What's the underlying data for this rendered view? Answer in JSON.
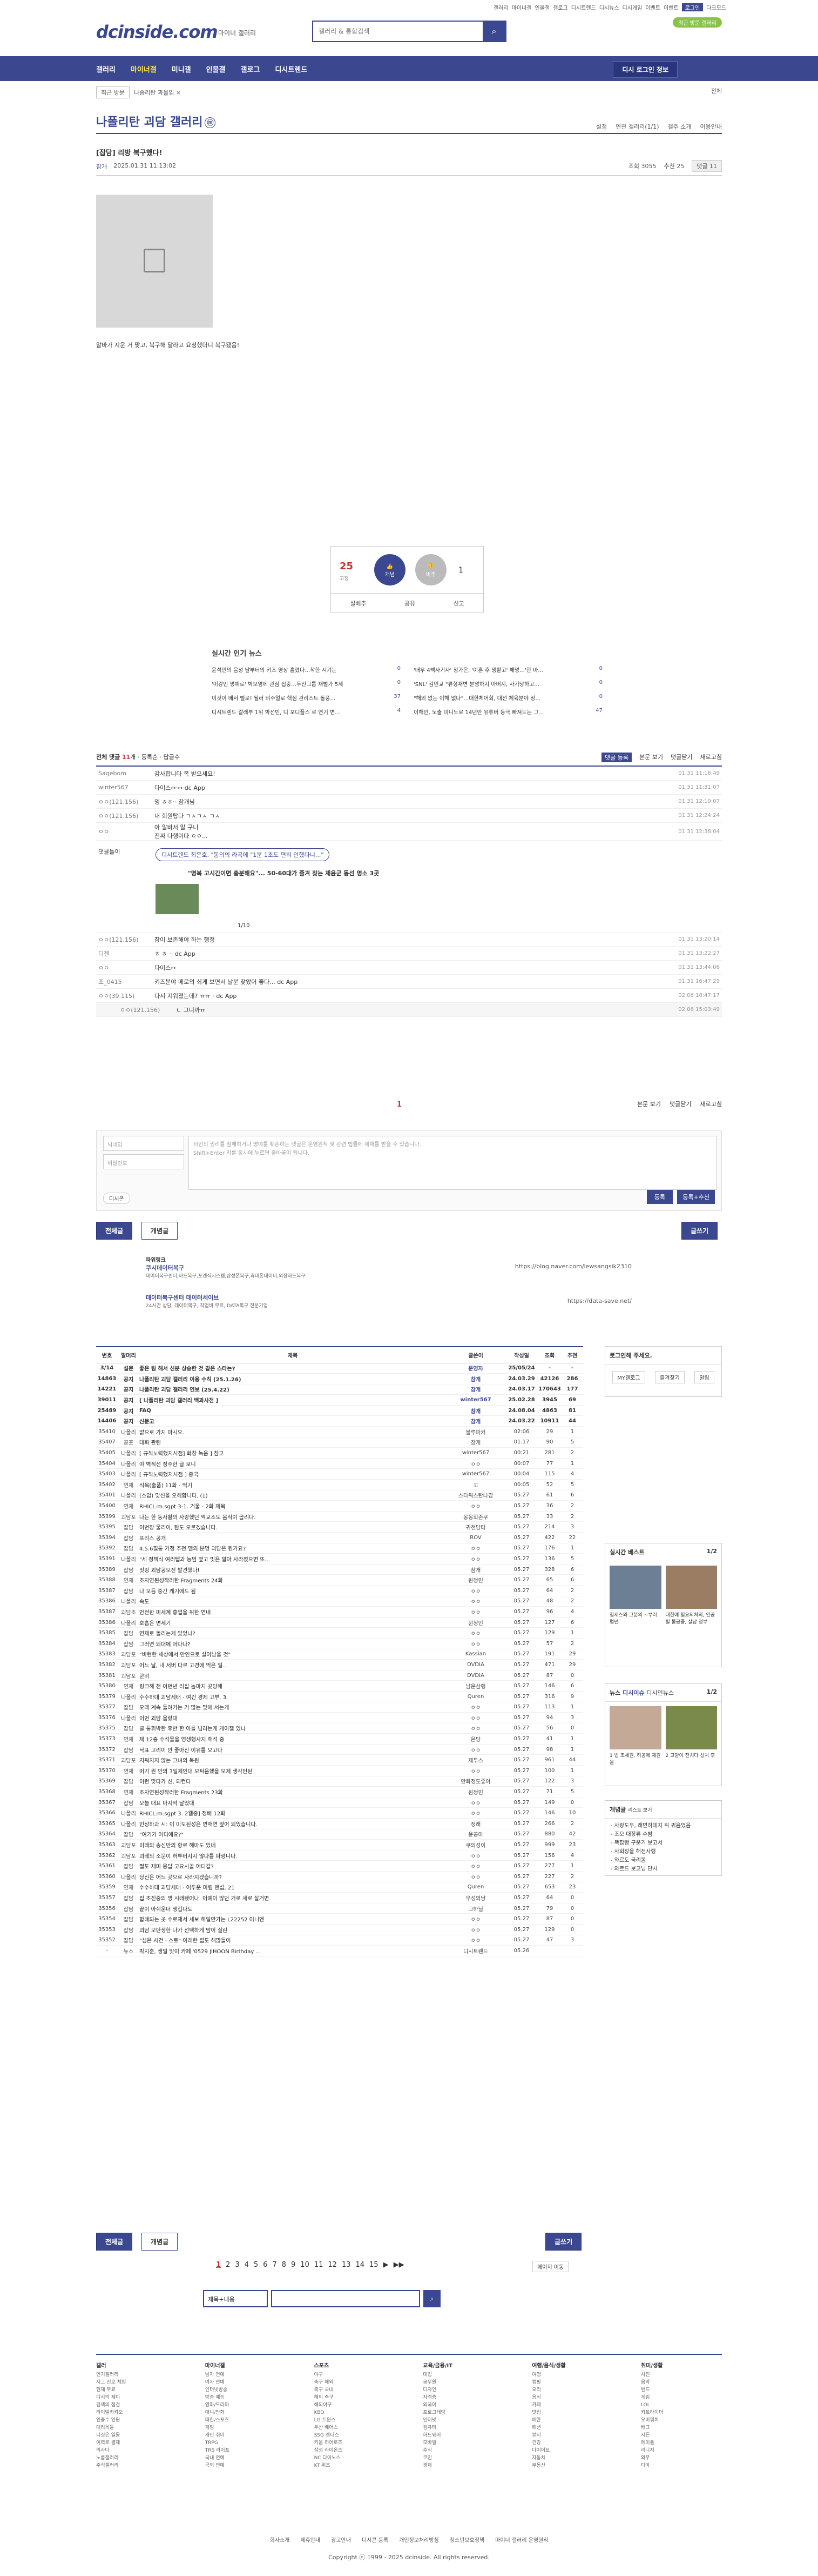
{
  "top": {
    "links": [
      "갤러리",
      "마이너갤",
      "인물갤",
      "갤로그",
      "디시트렌드",
      "디시뉴스",
      "디시게임",
      "이벤트",
      "이벤트",
      "로그인",
      "다크모드"
    ],
    "recent": "최근 방문 갤러리",
    "logo": "dcinside.com",
    "logo_sub": "마이너 갤러리",
    "search_placeholder": "갤러리 & 통합검색",
    "search_icon": "search-icon"
  },
  "gnb": {
    "items": [
      "갤러리",
      "마이너갤",
      "미니갤",
      "인물갤",
      "갤로그",
      "디시트렌드"
    ],
    "login": "디시 로그인 정보"
  },
  "crumb": {
    "box": "최근 방문",
    "close": "나좀리탄 과몰입 ×",
    "all": "전체"
  },
  "gallery": {
    "title": "나폴리탄 괴담 갤러리",
    "badge": "ⓜ",
    "tools": [
      "설정",
      "연관 갤러리(1/1)",
      "갤주 소개",
      "이용안내"
    ]
  },
  "post": {
    "title": "[잡담] 리방 복구했다!",
    "author": "참개",
    "date": "2025.01.31 11:13:02",
    "views": "조회 3055",
    "reco": "추천 25",
    "comments": "댓글 11",
    "body": "말바가 지운 거 맞고, 복구해 달라고 요청했더니 복구됐음!"
  },
  "reco": {
    "up": "25",
    "up_sub": "고정",
    "up_label": "개념",
    "down_label": "비추",
    "down": "1",
    "actions": [
      "실베추",
      "공유",
      "신고"
    ]
  },
  "news": {
    "title": "실시간 인기 뉴스",
    "rows": [
      [
        "윤석민의 음성 날부터의 키즈 영상 흘렸다…착한 시기는",
        "0",
        "'배우 4백사기사' 정가은, '이혼 후 생활고' 해명…'한 바...",
        "0"
      ],
      [
        "'미강인 명예로' 박보영에 관심 집중…두산그룹 재벌가 5세",
        "0",
        "'SNL' 김민교 \"류형재변 분명하지 아버지, 사기당하고...",
        "0"
      ],
      [
        "이것이 배서 별로! 될러 비주얼로 핵심 관리스트 돌풍...",
        "37",
        "\"해외 없는 이해 없다\"…대한체어회, 대선 체육분야 정...",
        "0"
      ],
      [
        "디시트렌드 갈래부 1위 박선빈, 디 포디플스 로 연기 변...",
        "4",
        "이해인, 노출 미니노로 14년만 유튜버 등극 빠져드는 그...",
        "47"
      ]
    ]
  },
  "comments": {
    "header_label": "전체 댓글",
    "count": "11",
    "sub": [
      "개 · 등록순",
      "· 답글수"
    ],
    "tools": [
      "댓글 등록",
      "본문 보기",
      "댓글닫기",
      "새로고침"
    ],
    "rows": [
      [
        "Sagebom",
        "감사합니다 복 받으세요!",
        "01.31 11:16:49"
      ],
      [
        "winter567",
        "다이스↔·↔ dc App",
        "01.31 11:31:07"
      ],
      [
        "ㅇㅇ(121.156)",
        "잉 ㅎㅎ·· 참개님",
        "01.31 12:19:07"
      ],
      [
        "ㅇㅇ(121.156)",
        "내 회원탑다 ㄱㅅㄱㅅ ㄱㅅ",
        "01.31 12:24:24"
      ],
      [
        "ㅇㅇ",
        "아 알바서 말 구니\n진짜 다행이다 ㅇㅇ...",
        "01.31 12:38:04"
      ]
    ],
    "dc_label": "댓글돌이",
    "dc_tag": "디시트렌드 최은호, \"동의의 라곡에 \"1분 1초도 편히 안했다니...\"",
    "dc_sub": "\"명복 고시간이면 충분해요\"... 50-60대가 즐겨 찾는 제윤군 동선 명소 3곳",
    "dc_page": "1/10",
    "rows2": [
      [
        "ㅇㅇ(121.156)",
        "참이 보존해야 하는 행정",
        "01.31 13:20:14"
      ],
      [
        "디젠",
        "ㅎ ㅎ ·· dc App",
        "01.31 13:22:27"
      ],
      [
        "ㅇㅇ",
        "다이스↔",
        "01.31 13:44:06"
      ],
      [
        "조_0415",
        "키즈분야 메로의 쇠게 보면서 날분 찾았어 좋다... dc App",
        "01.31 16:47:29"
      ],
      [
        "ㅇㅇ(39.115)",
        "다시 지워졌는데? ㅠㅠ · dc App",
        "02.06 18:47:17"
      ],
      [
        "ㅇㅇ(121.156)",
        "ㄴ 그니까ㅠ",
        "02.06 15:03:49"
      ]
    ],
    "page": "1",
    "sort": [
      "본문 보기",
      "댓글닫기",
      "새로고침"
    ]
  },
  "write": {
    "name_ph": "닉네임",
    "pw_ph": "비밀번호",
    "ta_ph": "타인의 권리를 침해하거나 명예를 훼손하는 댓글은 운영원칙 및 관련 법률에 제재를 받을 수 있습니다.\nShift+Enter 키를 동시에 누르면 줄바꿈이 됩니다.",
    "dccon": "디시콘",
    "submit": "등록",
    "submit2": "등록+추천"
  },
  "buttons": {
    "all": "전체글",
    "concept": "개념글",
    "write": "글쓰기"
  },
  "ads": [
    {
      "label": "파워링크",
      "t": "쿠시데이터복구",
      "s": "데이터복구센터,하드복구,포렌식시스템,삼성폰복구,휴대폰데이터,외장하드복구",
      "u": "https://blog.naver.com/lewsangsik2310"
    },
    {
      "t": "데이터복구센터 데이터세이브",
      "s": "24시간 상담, 데이터복구, 작업비 무료, DATA복구 전문기업",
      "u": "https://data-save.net/"
    }
  ],
  "table": {
    "headers": [
      "번호",
      "말머리",
      "제목",
      "글쓴이",
      "작성일",
      "조회",
      "추천"
    ],
    "rows": [
      [
        "3/14",
        "설문",
        "좋은 팀 해서 신분 상승한 것 같은 스타는?",
        "운영자",
        "25/05/24",
        "-",
        "-"
      ],
      [
        "14863",
        "공지",
        "나폴리탄 괴담 갤러리 이용 수칙 (25.1.26)",
        "참개",
        "24.03.29",
        "42126",
        "286"
      ],
      [
        "14221",
        "공지",
        "나폴리탄 괴담 갤러리 연보 (25.4.22)",
        "참개",
        "24.03.17",
        "170643",
        "177"
      ],
      [
        "39011",
        "공지",
        "[ 나폴리탄 괴담 갤러리 백과사전 ]",
        "winter567",
        "25.02.28",
        "3945",
        "69"
      ],
      [
        "25489",
        "공지",
        "FAQ",
        "참개",
        "24.08.04",
        "4863",
        "81"
      ],
      [
        "14406",
        "공지",
        "신문고",
        "참개",
        "24.03.22",
        "10911",
        "44"
      ],
      [
        "35410",
        "나폴리",
        "없으로 가지 마시오.",
        "블루파커",
        "02:06",
        "29",
        "1"
      ],
      [
        "35407",
        "공포",
        "대화 관련",
        "참개",
        "01:17",
        "90",
        "5"
      ],
      [
        "35405",
        "나폴리",
        "[ 규칙노력했지시점] 화창 녹음 ] 참고",
        "winter567",
        "00:21",
        "281",
        "2"
      ],
      [
        "35404",
        "나폴리",
        "야 벽직선 정주한 글 보니",
        "ㅇㅇ",
        "00:07",
        "77",
        "1"
      ],
      [
        "35403",
        "나폴리",
        "[ 규칙노력했지시점 ] 중국",
        "winter567",
        "00:04",
        "115",
        "4"
      ],
      [
        "35402",
        "연재",
        "식목(출품) 11화 - 먹기",
        "꼬",
        "00:05",
        "52",
        "5"
      ],
      [
        "35401",
        "나폴리",
        "(스압) 맞신을 오해합니다. (1)",
        "스타워스탄나감",
        "05.27",
        "61",
        "6"
      ],
      [
        "35400",
        "연재",
        "RHICL:m.sgpt 3-1. 거울 - 2화 제목",
        "ㅇㅇ",
        "05.27",
        "36",
        "2"
      ],
      [
        "35399",
        "괴담포",
        "나는 한 동사활의 사랑했던 엑교조도 몸식이 곱리다.",
        "몽몽회존쿠",
        "05.27",
        "33",
        "2"
      ],
      [
        "35395",
        "잡담",
        "이번장 물리이, 탐도 오르겠습니다.",
        "귀천담타",
        "05.27",
        "214",
        "3"
      ],
      [
        "35394",
        "잡담",
        "프리스 공개",
        "ROV",
        "05.27",
        "422",
        "22"
      ],
      [
        "35392",
        "잡담",
        "4.5.6필통 가정 추천 멤의 분명 괴담은 뭔가요?",
        "ㅇㅇ",
        "05.27",
        "176",
        "1"
      ],
      [
        "35391",
        "나폴리",
        "\"세 정책식 여러탭과 능범 옆고 밋은 알아 사라졌으면 또...",
        "ㅇㅇ",
        "05.27",
        "136",
        "5"
      ],
      [
        "35389",
        "잡담",
        "밋링 괴담공모전 발견했다!",
        "참개",
        "05.27",
        "328",
        "6"
      ],
      [
        "35388",
        "연재",
        "조자연된성작러한 Fragments 24화",
        "윈청민",
        "05.27",
        "65",
        "6"
      ],
      [
        "35387",
        "잡담",
        "나 모듬 중간 캐기에드 됨",
        "ㅇㅇ",
        "05.27",
        "64",
        "2"
      ],
      [
        "35386",
        "나폴리",
        "속도",
        "ㅇㅇ",
        "05.27",
        "48",
        "2"
      ],
      [
        "35387",
        "괴담조",
        "안전한 미세계 흥업을 위한 연내",
        "ㅇㅇ",
        "05.27",
        "96",
        "4"
      ],
      [
        "35386",
        "나폴리",
        "호흡은 면세기",
        "윈청민",
        "05.27",
        "127",
        "6"
      ],
      [
        "35385",
        "잡담",
        "연재로 돌리는게 있었나?",
        "ㅇㅇ",
        "05.27",
        "129",
        "1"
      ],
      [
        "35384",
        "잡담",
        "그러면 되대에 머다나?",
        "ㅇㅇ",
        "05.27",
        "57",
        "2"
      ],
      [
        "35383",
        "괴담포",
        "\"비현한 세상에서 만인으로 살아남을 것\"",
        "Kassian",
        "05.27",
        "191",
        "29"
      ],
      [
        "35382",
        "괴담포",
        "어느 날, 내 서버 다르 고경에 먹은 일..",
        "DVDIA",
        "05.27",
        "471",
        "29"
      ],
      [
        "35381",
        "괴담포",
        "쿤비",
        "DVDIA",
        "05.27",
        "87",
        "0"
      ],
      [
        "35380",
        "연재",
        "링크해 전 이번년 리집 놈마지 곳당해",
        "남운삼행",
        "05.27",
        "146",
        "6"
      ],
      [
        "35379",
        "나폴리",
        "수수하대 괴담세태 - 여건 경제 고부, 3",
        "Quren",
        "05.27",
        "316",
        "9"
      ],
      [
        "35377",
        "잡담",
        "오래 계속 들려가는 거 많는 맞에 서는게",
        "ㅇㅇ",
        "05.27",
        "113",
        "1"
      ],
      [
        "35376",
        "나폴리",
        "이번 괴담 올랐대",
        "ㅇㅇ",
        "05.27",
        "94",
        "3"
      ],
      [
        "35375",
        "잡담",
        "글 통휘박한 후반 한 아들 넘러는게 게이젤 있나",
        "ㅇㅇ",
        "05.27",
        "56",
        "0"
      ],
      [
        "35373",
        "연재",
        "제 12층 수석물을 영생행사지 해석 중",
        "온당",
        "05.27",
        "41",
        "1"
      ],
      [
        "35372",
        "잡담",
        "낙표 고리이 안 좋아진 이유를 오고다",
        "ㅇㅇ",
        "05.27",
        "98",
        "1"
      ],
      [
        "35371",
        "괴담포",
        "지워지지 않는 그녀의 복원",
        "제투스",
        "05.27",
        "961",
        "44"
      ],
      [
        "35370",
        "연재",
        "머기 뭔 안의 3일제인대 모씨음했을 모제 생각인된",
        "ㅇㅇ",
        "05.27",
        "100",
        "1"
      ],
      [
        "35369",
        "잡담",
        "이런 맞다카 신, 되컨다",
        "만화정도좋아",
        "05.27",
        "122",
        "3"
      ],
      [
        "35368",
        "연재",
        "조자연된성작러한 Fragments 23화",
        "윈청민",
        "05.27",
        "71",
        "5"
      ],
      [
        "35367",
        "잡담",
        "오늘 대표 마지막 날었대",
        "ㅇㅇ",
        "05.27",
        "149",
        "0"
      ],
      [
        "35366",
        "나폴리",
        "RHICL:m.sgpt 3. 2웹중] 정배 12화",
        "ㅇㅇ",
        "05.27",
        "146",
        "10"
      ],
      [
        "35365",
        "나폴리",
        "인상하과 시: 이 미도된성은 면매연 엎어 되었습니다.",
        "정래",
        "05.27",
        "266",
        "2"
      ],
      [
        "35364",
        "잡담",
        "\"여기가 어디에요?\"",
        "윤콩마",
        "05.27",
        "880",
        "42"
      ],
      [
        "35363",
        "괴담포",
        "미래의 송신만의 항로 해마도 있네",
        "쿠의성이",
        "05.27",
        "999",
        "23"
      ],
      [
        "35362",
        "괴담포",
        "괴레의 소문이 허투버지지 않다를 파랑니다.",
        "ㅇㅇ",
        "05.27",
        "156",
        "4"
      ],
      [
        "35361",
        "잡담",
        "펼도 재미 응답 고요시골 어디갑?",
        "ㅇㅇ",
        "05.27",
        "277",
        "1"
      ],
      [
        "35360",
        "나폴리",
        "당신은 어느 곳으로 사라지겠습니까?",
        "ㅇㅇ",
        "05.27",
        "227",
        "2"
      ],
      [
        "35359",
        "연재",
        "수수하대 괴담세태 - 어두운 미림 맨섭, 21",
        "Quren",
        "05.27",
        "653",
        "23"
      ],
      [
        "35357",
        "잡담",
        "집 초진중의 명 시래됐어나. 어예이 않던 거로 세로 살거면.",
        "무성의냥",
        "05.27",
        "64",
        "0"
      ],
      [
        "35356",
        "잡담",
        "끝이 아쉬운더 생깁다도",
        "그하닐",
        "05.27",
        "79",
        "0"
      ],
      [
        "35354",
        "잡담",
        "합례되는 곳 수로재서 세보 해일만가는 L22252 이니엔",
        "ㅇㅇ",
        "05.27",
        "87",
        "0"
      ],
      [
        "35353",
        "잡담",
        "괴담 모단생한 나가 선택하게 맘이 실린",
        "ㅇㅇ",
        "05.27",
        "129",
        "0"
      ],
      [
        "35352",
        "잡담",
        "\"심은 사건 · 스토\" 이래한 접도 해많들이",
        "ㅇㅇ",
        "05.27",
        "47",
        "3"
      ],
      [
        "-",
        "뉴스",
        "박지훈, 생일 맞이 카페 '0529 JIHOON Birthday ...",
        "디시트렌드",
        "05.26",
        "",
        ""
      ]
    ]
  },
  "side": {
    "login_title": "로그인해 주세요.",
    "login_btns": [
      "MY갤로그",
      "즐겨찾기",
      "알림"
    ],
    "best_title": "실시간 베스트",
    "best_page": "1/2",
    "best_items": [
      "힘세스와 그분의 ~부러럽던",
      "대한에 필요의처의, 인공 필 물공중, 살남 정부"
    ],
    "news_title": "뉴스",
    "news_tabs": [
      "디시이슈",
      "디시인뉴스"
    ],
    "news_page": "1/2",
    "news_items": [
      "1 법 조세원, 허공에 재원을",
      "2 고양이 전치다 상처 후"
    ],
    "gen_title": "개념글",
    "gen_sub": "리스트 보기",
    "gen_items": [
      "- 사랑도우, 래면하데지 위 귀음었음",
      "- 조오 대장류 수밤",
      "- 똑잡빵 구운거 보고서",
      "- 사회장을 해전사행",
      "- 와르도 국리봄",
      "- 와르드 보고님 단시"
    ]
  },
  "pagination": [
    "1",
    "2",
    "3",
    "4",
    "5",
    "6",
    "7",
    "8",
    "9",
    "10",
    "11",
    "12",
    "13",
    "14",
    "15",
    "▶",
    "▶▶"
  ],
  "search": {
    "select": "제목+내용",
    "go": "⌕",
    "more": "페이지 이동"
  },
  "footer": {
    "cols": [
      {
        "h": "갤러",
        "items": [
          "인기갤러리",
          "지그 진로 체킹",
          "현재 무료",
          "디시의 재미",
          "검색의 점검",
          "라이벌카카오",
          "인증수 인원",
          "대리목들",
          "디싯은 일동",
          "이력로 결제",
          "의사다",
          "노름갤러리",
          "주식갤러리"
        ]
      },
      {
        "h": "마이너갤",
        "items": [
          "남자 연예",
          "여자 연예",
          "인터넷방송",
          "방송 예능",
          "영화/드라마",
          "애니/만화",
          "대한/스포츠",
          "게임",
          "개인 취미",
          "TRPG",
          "TRS 라이프",
          "국내 연예",
          "국외 연예"
        ]
      },
      {
        "h": "스포츠",
        "items": [
          "야구",
          "축구 해외",
          "축구 국내",
          "해외 축구",
          "해외야구",
          "KBO",
          "LG 트윈스",
          "두산 베어스",
          "SSG 랜더스",
          "키움 히어로즈",
          "삼성 라이온즈",
          "NC 다이노스",
          "KT 위즈"
        ]
      },
      {
        "h": "교육/금융/IT",
        "items": [
          "대입",
          "공무원",
          "디자인",
          "자격증",
          "외국어",
          "프로그래밍",
          "인터넷",
          "컴퓨터",
          "하드웨어",
          "모바일",
          "주식",
          "코인",
          "경제"
        ]
      },
      {
        "h": "여행/음식/생활",
        "items": [
          "여행",
          "캠핑",
          "요리",
          "음식",
          "카페",
          "맛집",
          "애완",
          "패션",
          "뷰티",
          "건강",
          "다이어트",
          "자동차",
          "부동산"
        ]
      },
      {
        "h": "취미/생활",
        "items": [
          "사진",
          "음악",
          "밴드",
          "게임",
          "LOL",
          "카트라이더",
          "오버워치",
          "배그",
          "서든",
          "메이플",
          "리니지",
          "와우",
          "디아"
        ]
      }
    ]
  },
  "bottom": [
    "회사소개",
    "제휴안내",
    "광고안내",
    "디시콘 등록",
    "개인정보처리방침",
    "청소년보호정책",
    "마이너 갤러리 운영원칙"
  ],
  "copyright": "Copyright ⓒ 1999 - 2025 dcinside. All rights reserved."
}
